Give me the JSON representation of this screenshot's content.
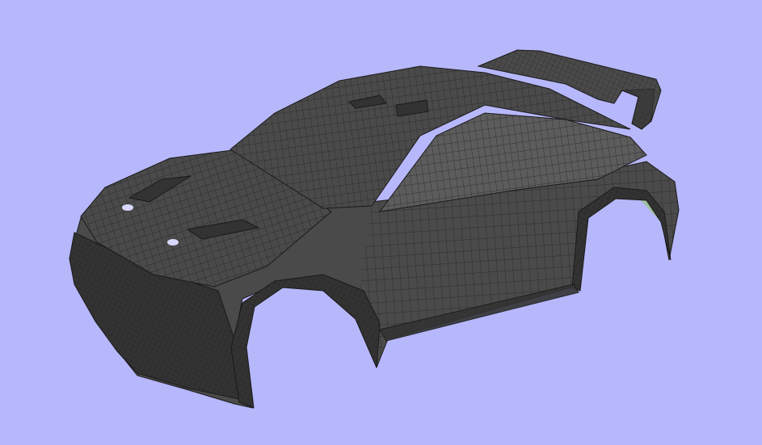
{
  "viewport": {
    "background": "#b7b7fb",
    "model": {
      "body_color": "#4a4a4a",
      "body_dark": "#333333",
      "body_light": "#5c5c5c",
      "mesh_line_color": "#1a1a1a",
      "interior_color": "#9fbf9f",
      "underside_color": "#6e8a6e"
    }
  }
}
